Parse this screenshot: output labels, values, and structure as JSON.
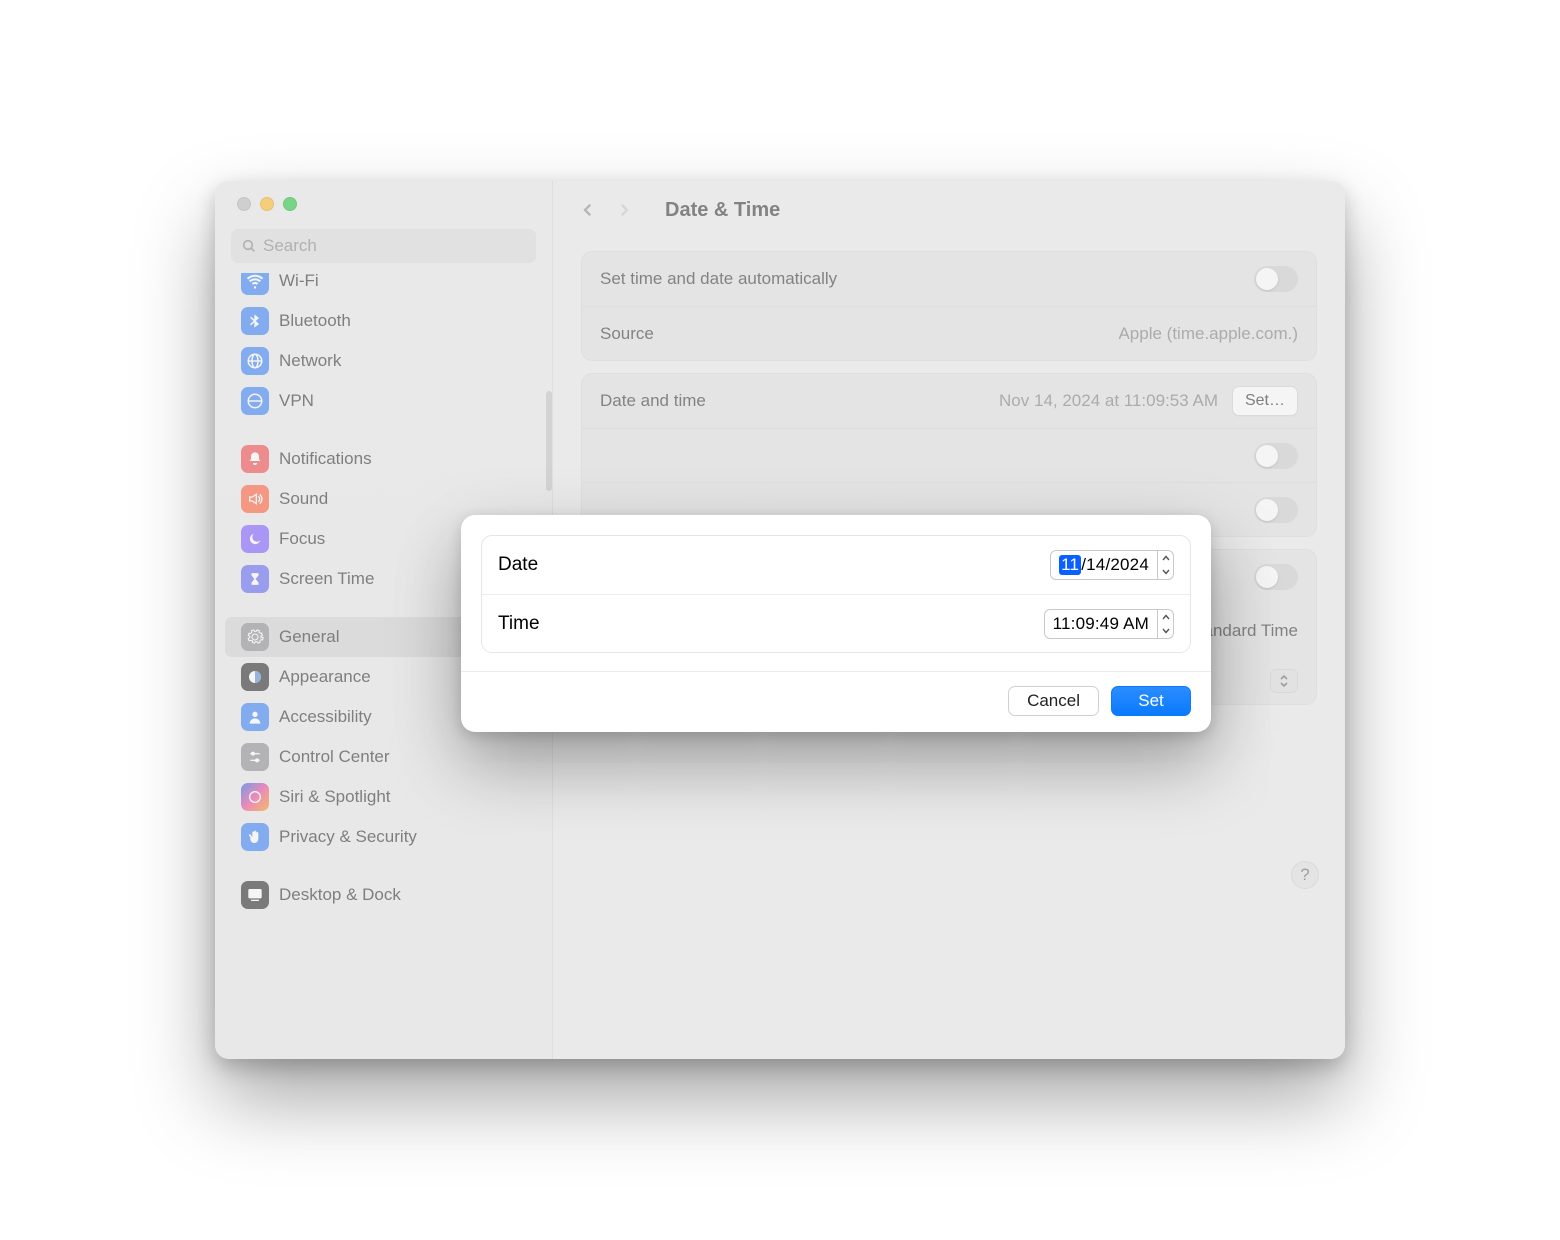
{
  "header": {
    "title": "Date & Time"
  },
  "search": {
    "placeholder": "Search"
  },
  "sidebar": {
    "items": [
      {
        "label": "Wi-Fi",
        "icon": "wifi-icon",
        "color": "ic-blue"
      },
      {
        "label": "Bluetooth",
        "icon": "bluetooth-icon",
        "color": "ic-blue"
      },
      {
        "label": "Network",
        "icon": "globe-icon",
        "color": "ic-blue"
      },
      {
        "label": "VPN",
        "icon": "vpn-icon",
        "color": "ic-blue"
      },
      {
        "label": "Notifications",
        "icon": "bell-icon",
        "color": "ic-red"
      },
      {
        "label": "Sound",
        "icon": "speaker-icon",
        "color": "ic-orange"
      },
      {
        "label": "Focus",
        "icon": "moon-icon",
        "color": "ic-purple"
      },
      {
        "label": "Screen Time",
        "icon": "hourglass-icon",
        "color": "ic-indigo"
      },
      {
        "label": "General",
        "icon": "gear-icon",
        "color": "ic-gray"
      },
      {
        "label": "Appearance",
        "icon": "appearance-icon",
        "color": "ic-black"
      },
      {
        "label": "Accessibility",
        "icon": "person-icon",
        "color": "ic-blue"
      },
      {
        "label": "Control Center",
        "icon": "sliders-icon",
        "color": "ic-gray"
      },
      {
        "label": "Siri & Spotlight",
        "icon": "siri-icon",
        "color": "ic-grad"
      },
      {
        "label": "Privacy & Security",
        "icon": "hand-icon",
        "color": "ic-blue"
      },
      {
        "label": "Desktop & Dock",
        "icon": "desktop-icon",
        "color": "ic-black"
      }
    ],
    "selectedIndex": 8
  },
  "rows": {
    "auto_label": "Set time and date automatically",
    "source_label": "Source",
    "source_value": "Apple (time.apple.com.)",
    "datetime_label": "Date and time",
    "datetime_value": "Nov 14, 2024 at 11:09:53 AM",
    "set_button": "Set…",
    "timezone_tail": "Standard Time"
  },
  "help": "?",
  "modal": {
    "date_label": "Date",
    "date_selected_segment": "11",
    "date_rest": "/14/2024",
    "time_label": "Time",
    "time_value": "11:09:49 AM",
    "cancel": "Cancel",
    "set": "Set"
  }
}
